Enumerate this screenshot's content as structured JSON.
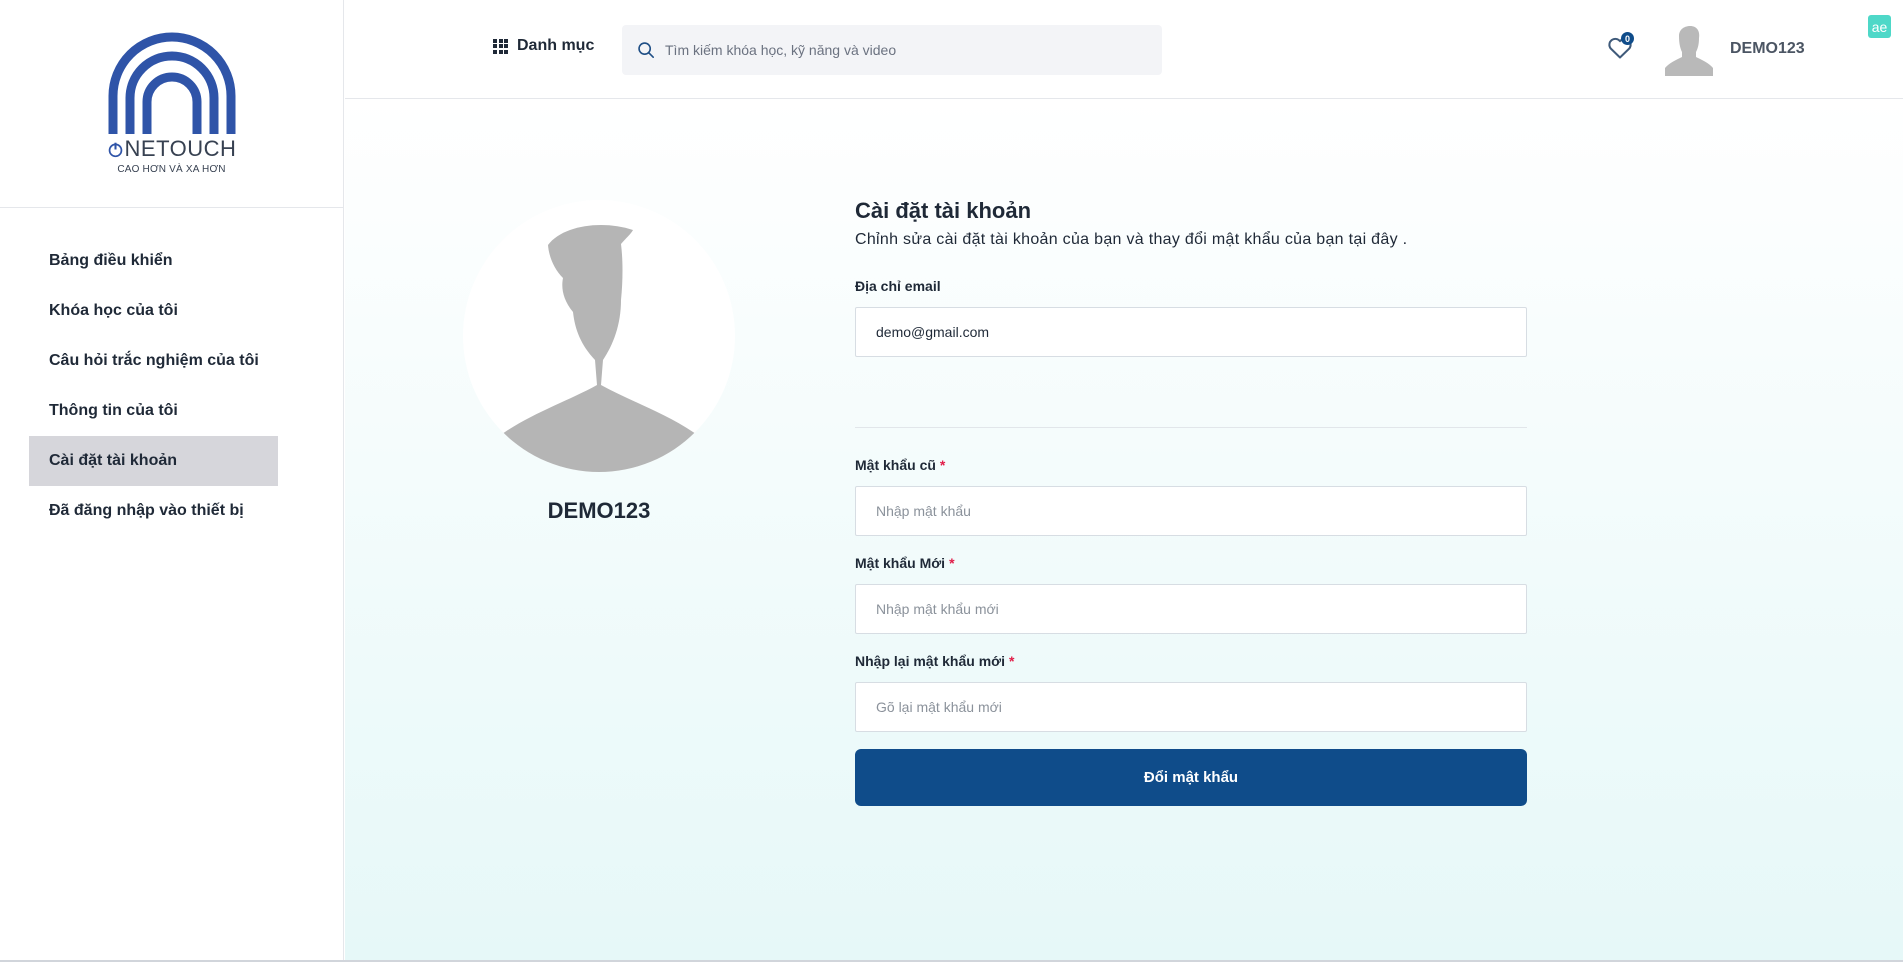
{
  "brand": {
    "name_suffix": "NETOUCH",
    "tagline": "CAO HƠN VÀ XA HƠN",
    "color": "#2f54a8"
  },
  "sidebar": {
    "items": [
      {
        "label": "Bảng điều khiển",
        "active": false
      },
      {
        "label": "Khóa học của tôi",
        "active": false
      },
      {
        "label": "Câu hỏi trắc nghiệm của tôi",
        "active": false
      },
      {
        "label": "Thông tin của tôi",
        "active": false
      },
      {
        "label": "Cài đặt tài khoản",
        "active": true
      },
      {
        "label": "Đã đăng nhập vào thiết bị",
        "active": false
      }
    ]
  },
  "header": {
    "category_label": "Danh mục",
    "search_placeholder": "Tìm kiếm khóa học, kỹ năng và video",
    "wishlist_count": "0",
    "username": "DEMO123",
    "extension_icon": "ae",
    "icons": [
      "grid-icon",
      "search-icon",
      "heart-icon",
      "avatar-icon"
    ]
  },
  "profile": {
    "username": "DEMO123"
  },
  "form": {
    "title": "Cài đặt tài khoản",
    "subtitle": "Chỉnh sửa cài đặt tài khoản của bạn và thay đổi mật khẩu của bạn tại đây .",
    "email_label": "Địa chỉ email",
    "email_value": "demo@gmail.com",
    "old_password_label": "Mật khẩu cũ",
    "old_password_placeholder": "Nhập mật khẩu",
    "new_password_label": "Mật khẩu Mới",
    "new_password_placeholder": "Nhập mật khẩu mới",
    "confirm_password_label": "Nhập lại mật khẩu mới",
    "confirm_password_placeholder": "Gõ lại mật khẩu mới",
    "required_mark": "*",
    "submit_label": "Đổi mật khẩu"
  },
  "colors": {
    "primary": "#0f4c8a",
    "active_nav": "#d6d6db",
    "required": "#e11d48"
  }
}
